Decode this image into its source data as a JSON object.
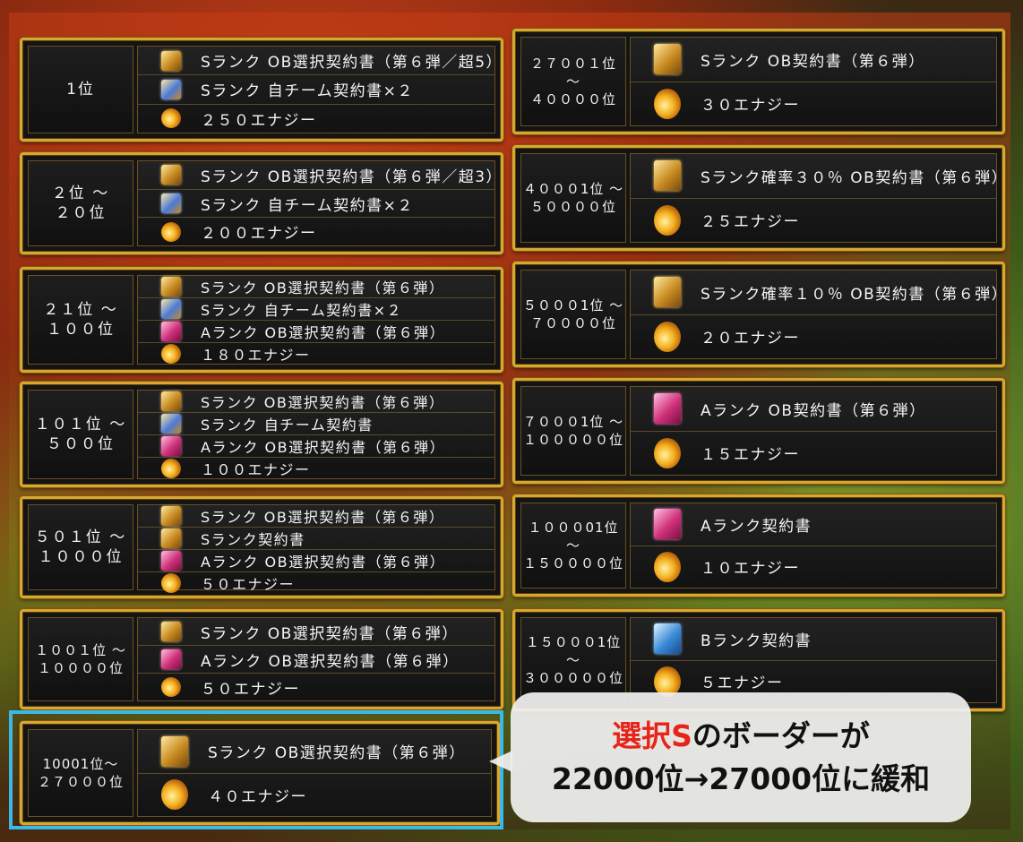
{
  "left_rows": [
    {
      "rank": "1位",
      "items": [
        {
          "icon": "s-contract-gold-icon",
          "text": "Sランク OB選択契約書（第６弾／超5）"
        },
        {
          "icon": "s-contract-blue-icon",
          "text": "Sランク 自チーム契約書×２"
        },
        {
          "icon": "energy-icon",
          "text": "２５０エナジー"
        }
      ]
    },
    {
      "rank": "２位 ～\n２０位",
      "items": [
        {
          "icon": "s-contract-gold-icon",
          "text": "Sランク OB選択契約書（第６弾／超3）"
        },
        {
          "icon": "s-contract-blue-icon",
          "text": "Sランク 自チーム契約書×２"
        },
        {
          "icon": "energy-icon",
          "text": "２００エナジー"
        }
      ]
    },
    {
      "rank": "２１位 ～\n１００位",
      "items": [
        {
          "icon": "s-contract-gold-icon",
          "text": "Sランク OB選択契約書（第６弾）"
        },
        {
          "icon": "s-contract-blue-icon",
          "text": "Sランク 自チーム契約書×２"
        },
        {
          "icon": "a-contract-pink-icon",
          "text": "Aランク OB選択契約書（第６弾）"
        },
        {
          "icon": "energy-icon",
          "text": "１８０エナジー"
        }
      ]
    },
    {
      "rank": "１０１位 ～\n５００位",
      "items": [
        {
          "icon": "s-contract-gold-icon",
          "text": "Sランク OB選択契約書（第６弾）"
        },
        {
          "icon": "s-contract-blue-icon",
          "text": "Sランク 自チーム契約書"
        },
        {
          "icon": "a-contract-pink-icon",
          "text": "Aランク OB選択契約書（第６弾）"
        },
        {
          "icon": "energy-icon",
          "text": "１００エナジー"
        }
      ]
    },
    {
      "rank": "５０１位 ～\n１０００位",
      "items": [
        {
          "icon": "s-contract-gold-icon",
          "text": "Sランク OB選択契約書（第６弾）"
        },
        {
          "icon": "s-contract-gold-icon",
          "text": "Sランク契約書"
        },
        {
          "icon": "a-contract-pink-icon",
          "text": "Aランク OB選択契約書（第６弾）"
        },
        {
          "icon": "energy-icon",
          "text": "５０エナジー"
        }
      ]
    },
    {
      "rank": "１００１位 ～\n１００００位",
      "items": [
        {
          "icon": "s-contract-gold-icon",
          "text": "Sランク OB選択契約書（第６弾）"
        },
        {
          "icon": "a-contract-pink-icon",
          "text": "Aランク OB選択契約書（第６弾）"
        },
        {
          "icon": "energy-icon",
          "text": "５０エナジー"
        }
      ]
    },
    {
      "rank": "10001位～\n２７０００位",
      "items": [
        {
          "icon": "s-contract-gold-icon",
          "text": "Sランク OB選択契約書（第６弾）"
        },
        {
          "icon": "energy-icon",
          "text": "４０エナジー"
        }
      ]
    }
  ],
  "right_rows": [
    {
      "rank": "２７００１位 ～\n４００００位",
      "items": [
        {
          "icon": "s-contract-gold-icon",
          "text": "Sランク OB契約書（第６弾）"
        },
        {
          "icon": "energy-icon",
          "text": "３０エナジー"
        }
      ]
    },
    {
      "rank": "４０００1位 ～\n５００００位",
      "items": [
        {
          "icon": "s-contract-gold-icon",
          "text": "Sランク確率３０％ OB契約書（第６弾）"
        },
        {
          "icon": "energy-icon",
          "text": "２５エナジー"
        }
      ]
    },
    {
      "rank": "５０００1位 ～\n７００００位",
      "items": [
        {
          "icon": "s-contract-gold-icon",
          "text": "Sランク確率１０％ OB契約書（第６弾）"
        },
        {
          "icon": "energy-icon",
          "text": "２０エナジー"
        }
      ]
    },
    {
      "rank": "７０００1位 ～\n１０００００位",
      "items": [
        {
          "icon": "a-contract-pink-icon",
          "text": "Aランク OB契約書（第６弾）"
        },
        {
          "icon": "energy-icon",
          "text": "１５エナジー"
        }
      ]
    },
    {
      "rank": "１０００01位 ～\n１５００００位",
      "items": [
        {
          "icon": "a-contract-pink-icon",
          "text": "Aランク契約書"
        },
        {
          "icon": "energy-icon",
          "text": "１０エナジー"
        }
      ]
    },
    {
      "rank": "１５０００1位 ～\n３０００００位",
      "items": [
        {
          "icon": "b-contract-blue-icon",
          "text": "Bランク契約書"
        },
        {
          "icon": "energy-icon",
          "text": "５エナジー"
        }
      ]
    }
  ],
  "callout": {
    "line1_red": "選択S",
    "line1_rest": "のボーダーが",
    "line2": "22000位→27000位に緩和"
  },
  "colors": {
    "frame_gold": "#d9a630",
    "highlight_blue": "#3cb8e8",
    "callout_red": "#e8241a"
  }
}
